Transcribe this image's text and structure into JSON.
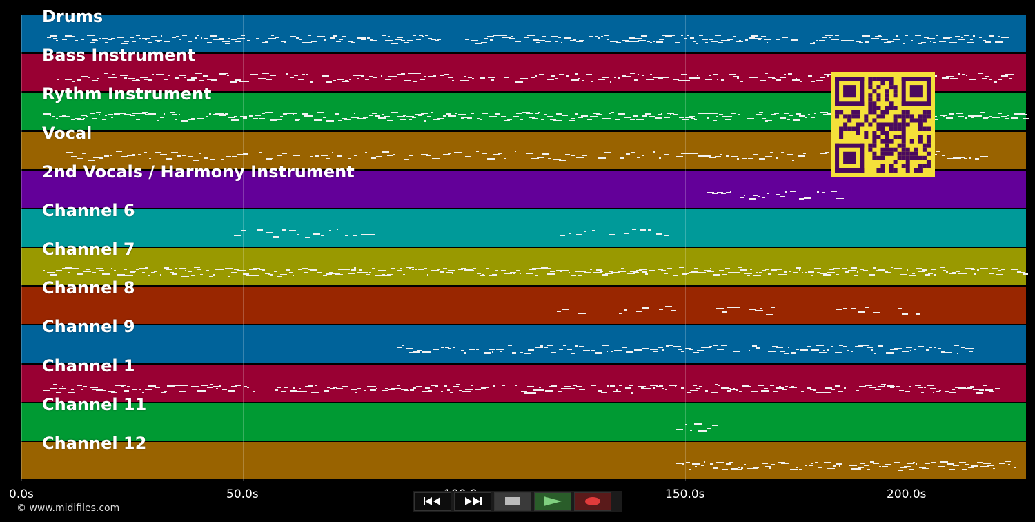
{
  "tracks": [
    {
      "label": "Drums",
      "color": "#00639a"
    },
    {
      "label": "Bass Instrument",
      "color": "#990033"
    },
    {
      "label": "Rythm Instrument",
      "color": "#009a33"
    },
    {
      "label": "Vocal",
      "color": "#996300"
    },
    {
      "label": "2nd Vocals / Harmony Instrument",
      "color": "#630099"
    },
    {
      "label": "Channel 6",
      "color": "#009a99"
    },
    {
      "label": "Channel 7",
      "color": "#999900"
    },
    {
      "label": "Channel 8",
      "color": "#992600"
    },
    {
      "label": "Channel 9",
      "color": "#00639a"
    },
    {
      "label": "Channel 1",
      "color": "#990033"
    },
    {
      "label": "Channel 11",
      "color": "#009a33"
    },
    {
      "label": "Channel 12",
      "color": "#996300"
    }
  ],
  "time_axis": {
    "max_seconds": 227,
    "ticks": [
      {
        "value": 0,
        "label": "0.0s"
      },
      {
        "value": 50,
        "label": "50.0s"
      },
      {
        "value": 100,
        "label": "100.0s"
      },
      {
        "value": 150,
        "label": "150.0s"
      },
      {
        "value": 200,
        "label": "200.0s"
      }
    ]
  },
  "copyright": "© www.midifiles.com",
  "transport": {
    "rewind": "rewind-icon",
    "fast_forward": "fast-forward-icon",
    "stop": "stop-icon",
    "play": "play-icon",
    "record": "record-icon"
  },
  "qr_code": {
    "fg": "#4a0a5e",
    "bg": "#f5e13a"
  }
}
